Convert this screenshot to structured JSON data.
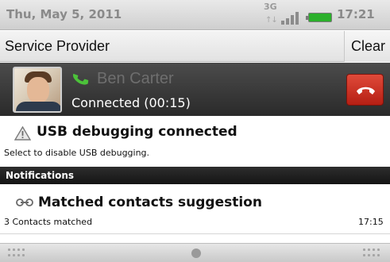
{
  "status_bar": {
    "date": "Thu, May 5, 2011",
    "network_type": "3G",
    "time": "17:21",
    "icons": [
      "3g-data-icon",
      "signal-strength-icon",
      "battery-icon"
    ],
    "battery_color": "#2bb02b"
  },
  "service_bar": {
    "title": "Service Provider",
    "clear_label": "Clear"
  },
  "ongoing_call": {
    "caller_name": "Ben Carter",
    "status": "Connected (00:15)",
    "call_icon": "phone-icon",
    "end_call_icon": "end-call-icon",
    "end_call_color": "#d33a2c"
  },
  "usb_notification": {
    "title": "USB debugging connected",
    "subtitle": "Select to disable USB debugging.",
    "icon": "warning-icon"
  },
  "notifications_header": "Notifications",
  "notifications": [
    {
      "title": "Matched contacts suggestion",
      "subtitle": "3 Contacts matched",
      "time": "17:15",
      "icon": "link-icon"
    }
  ]
}
